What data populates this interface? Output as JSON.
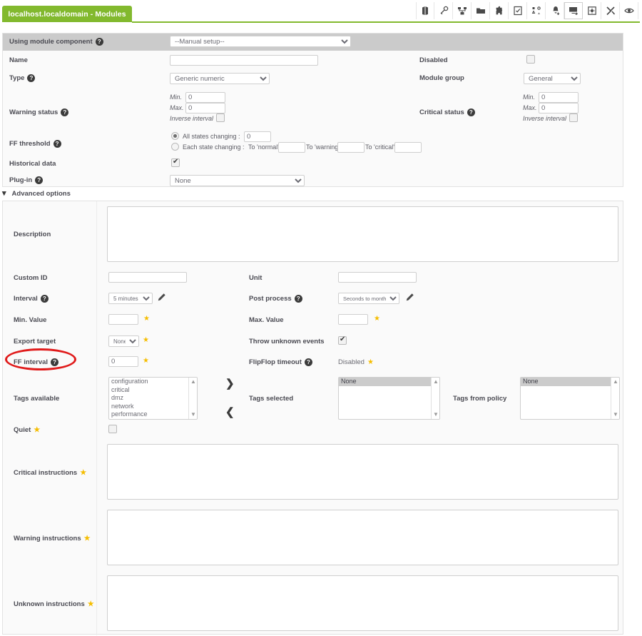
{
  "header": {
    "tab_label": "localhost.localdomain - Modules",
    "icons": [
      {
        "name": "book-icon",
        "selected": false
      },
      {
        "name": "key-icon",
        "selected": false
      },
      {
        "name": "network-map-icon",
        "selected": false
      },
      {
        "name": "folder-icon",
        "selected": false
      },
      {
        "name": "puzzle-icon",
        "selected": false
      },
      {
        "name": "checklist-icon",
        "selected": false
      },
      {
        "name": "collections-icon",
        "selected": false
      },
      {
        "name": "alert-add-icon",
        "selected": false
      },
      {
        "name": "monitor-add-icon",
        "selected": true
      },
      {
        "name": "gear-box-icon",
        "selected": false
      },
      {
        "name": "tools-icon",
        "selected": false
      },
      {
        "name": "eye-icon",
        "selected": false
      }
    ]
  },
  "main_form": {
    "using_module_component": {
      "label": "Using module component",
      "value": "--Manual setup--",
      "options": [
        "--Manual setup--"
      ]
    },
    "name": {
      "label": "Name",
      "value": ""
    },
    "type": {
      "label": "Type",
      "value": "Generic numeric",
      "options": [
        "Generic numeric"
      ]
    },
    "warning_status": {
      "label": "Warning status",
      "min_label": "Min.",
      "min_value": "0",
      "max_label": "Max.",
      "max_value": "0",
      "inverse_label": "Inverse interval",
      "inverse_checked": false
    },
    "ff_threshold": {
      "label": "FF threshold",
      "all_states_label": "All states changing :",
      "all_states_value": "0",
      "all_states_selected": true,
      "each_state_label": "Each state changing :",
      "each_state_selected": false,
      "to_normal_label": "To 'normal'",
      "to_normal_value": "",
      "to_warning_label": "To 'warning'",
      "to_warning_value": "",
      "to_critical_label": "To 'critical'",
      "to_critical_value": ""
    },
    "historical_data": {
      "label": "Historical data",
      "checked": true
    },
    "plugin": {
      "label": "Plug-in",
      "value": "None",
      "options": [
        "None"
      ]
    },
    "disabled": {
      "label": "Disabled",
      "checked": false
    },
    "module_group": {
      "label": "Module group",
      "value": "General",
      "options": [
        "General"
      ]
    },
    "critical_status": {
      "label": "Critical status",
      "min_label": "Min.",
      "min_value": "0",
      "max_label": "Max.",
      "max_value": "0",
      "inverse_label": "Inverse interval",
      "inverse_checked": false
    }
  },
  "advanced": {
    "section_label": "Advanced options",
    "description": {
      "label": "Description",
      "value": ""
    },
    "custom_id": {
      "label": "Custom ID",
      "value": ""
    },
    "unit": {
      "label": "Unit",
      "value": ""
    },
    "interval": {
      "label": "Interval",
      "value": "5 minutes",
      "options": [
        "5 minutes"
      ]
    },
    "post_process": {
      "label": "Post process",
      "value": "Seconds to months",
      "options": [
        "Seconds to months"
      ]
    },
    "min_value": {
      "label": "Min. Value",
      "value": ""
    },
    "max_value": {
      "label": "Max. Value",
      "value": ""
    },
    "export_target": {
      "label": "Export target",
      "value": "None",
      "options": [
        "None"
      ]
    },
    "throw_unknown_events": {
      "label": "Throw unknown events",
      "checked": true
    },
    "ff_interval": {
      "label": "FF interval",
      "value": "0"
    },
    "flipflop_timeout": {
      "label": "FlipFlop timeout",
      "value": "Disabled"
    },
    "tags_available": {
      "label": "Tags available",
      "options": [
        "configuration",
        "critical",
        "dmz",
        "network",
        "performance"
      ]
    },
    "tags_selected": {
      "label": "Tags selected",
      "options": [
        "None"
      ],
      "selected": "None"
    },
    "tags_from_policy": {
      "label": "Tags from policy",
      "options": [
        "None"
      ],
      "selected": "None"
    },
    "move_right_label": "❯",
    "move_left_label": "❮",
    "quiet": {
      "label": "Quiet",
      "checked": false
    },
    "critical_instructions": {
      "label": "Critical instructions",
      "value": ""
    },
    "warning_instructions": {
      "label": "Warning instructions",
      "value": ""
    },
    "unknown_instructions": {
      "label": "Unknown instructions",
      "value": ""
    }
  },
  "annotation": {
    "shape": "ellipse",
    "color": "#e01b1b",
    "target": "FF interval"
  },
  "colors": {
    "brand_green": "#82b92e",
    "band_gray": "#cbcbcb",
    "panel_bg": "#fafafa",
    "star_yellow": "#f5bd00",
    "annotation_red": "#e01b1b"
  }
}
